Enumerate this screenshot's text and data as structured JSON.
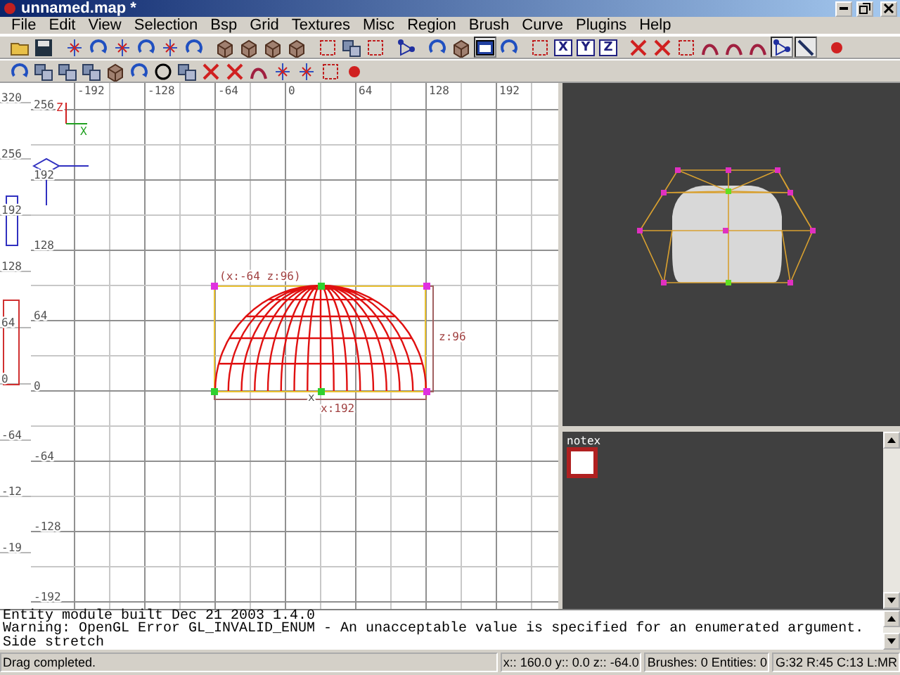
{
  "window": {
    "title": "unnamed.map *"
  },
  "menu": [
    "File",
    "Edit",
    "View",
    "Selection",
    "Bsp",
    "Grid",
    "Textures",
    "Misc",
    "Region",
    "Brush",
    "Curve",
    "Plugins",
    "Help"
  ],
  "toolbars": [
    [
      {
        "kind": "folder",
        "selected": false
      },
      {
        "kind": "disk",
        "selected": false
      },
      {
        "kind": "separator"
      },
      {
        "kind": "flip",
        "selected": false
      },
      {
        "kind": "rotate",
        "selected": false
      },
      {
        "kind": "flip",
        "selected": false
      },
      {
        "kind": "rotate",
        "selected": false
      },
      {
        "kind": "flip",
        "selected": false
      },
      {
        "kind": "rotate",
        "selected": false
      },
      {
        "kind": "separator"
      },
      {
        "kind": "cube",
        "selected": false
      },
      {
        "kind": "cube",
        "selected": false
      },
      {
        "kind": "cube",
        "selected": false
      },
      {
        "kind": "cube",
        "selected": false
      },
      {
        "kind": "separator"
      },
      {
        "kind": "select",
        "selected": false
      },
      {
        "kind": "squares",
        "selected": false
      },
      {
        "kind": "select",
        "selected": false
      },
      {
        "kind": "separator"
      },
      {
        "kind": "nodes",
        "selected": false
      },
      {
        "kind": "separator"
      },
      {
        "kind": "rotate",
        "selected": false
      },
      {
        "kind": "cube",
        "selected": false
      },
      {
        "kind": "window",
        "selected": true
      },
      {
        "kind": "rotate",
        "selected": false
      },
      {
        "kind": "separator"
      },
      {
        "kind": "select",
        "selected": false
      },
      {
        "kind": "letter",
        "label": "X",
        "selected": false
      },
      {
        "kind": "letter",
        "label": "Y",
        "selected": false
      },
      {
        "kind": "letter",
        "label": "Z",
        "selected": false
      },
      {
        "kind": "separator"
      },
      {
        "kind": "cross",
        "selected": false
      },
      {
        "kind": "cross",
        "selected": false
      },
      {
        "kind": "select",
        "selected": false
      },
      {
        "kind": "curve",
        "selected": false
      },
      {
        "kind": "curve",
        "selected": false
      },
      {
        "kind": "curve",
        "selected": false
      },
      {
        "kind": "nodes",
        "selected": true
      },
      {
        "kind": "line",
        "selected": true
      },
      {
        "kind": "separator"
      },
      {
        "kind": "dot",
        "selected": false
      }
    ],
    [
      {
        "kind": "rotate",
        "selected": false
      },
      {
        "kind": "squares",
        "selected": false
      },
      {
        "kind": "squares",
        "selected": false
      },
      {
        "kind": "squares",
        "selected": false
      },
      {
        "kind": "cube",
        "selected": false
      },
      {
        "kind": "rotate",
        "selected": false
      },
      {
        "kind": "circle",
        "selected": false
      },
      {
        "kind": "squares",
        "selected": false
      },
      {
        "kind": "cross",
        "selected": false
      },
      {
        "kind": "cross",
        "selected": false
      },
      {
        "kind": "curve",
        "selected": false
      },
      {
        "kind": "flip",
        "selected": false
      },
      {
        "kind": "flip",
        "selected": false
      },
      {
        "kind": "select",
        "selected": false
      },
      {
        "kind": "dot",
        "selected": false
      }
    ]
  ],
  "z_view": {
    "labels": [
      "320",
      "256",
      "192",
      "128",
      "64",
      "0",
      "-64",
      "-12",
      "-19"
    ]
  },
  "xz_view": {
    "x_labels": [
      "-192",
      "-128",
      "-64",
      "0",
      "64",
      "128",
      "192"
    ],
    "z_labels": [
      "256",
      "192",
      "128",
      "64",
      "0",
      "-64",
      "-128",
      "-192"
    ],
    "axis_labels": [
      "Z",
      "X"
    ],
    "selection": {
      "corner_label": "(x:-64  z:96)",
      "height_label": "z:96",
      "width_label": "x:192",
      "axis_mark": "x"
    }
  },
  "texture_browser": {
    "textures": [
      {
        "name": "notex",
        "selected": true
      }
    ]
  },
  "console": {
    "lines": [
      "Entity module built Dec 21 2003 1.4.0",
      "Warning: OpenGL Error GL_INVALID_ENUM - An unacceptable value is specified for an enumerated argument.",
      "Side stretch"
    ]
  },
  "status_bar": [
    "Drag completed.",
    "x:: 160.0  y:: 0.0  z:: -64.0",
    "Brushes: 0 Entities: 0",
    "G:32 R:45 C:13 L:MR"
  ]
}
